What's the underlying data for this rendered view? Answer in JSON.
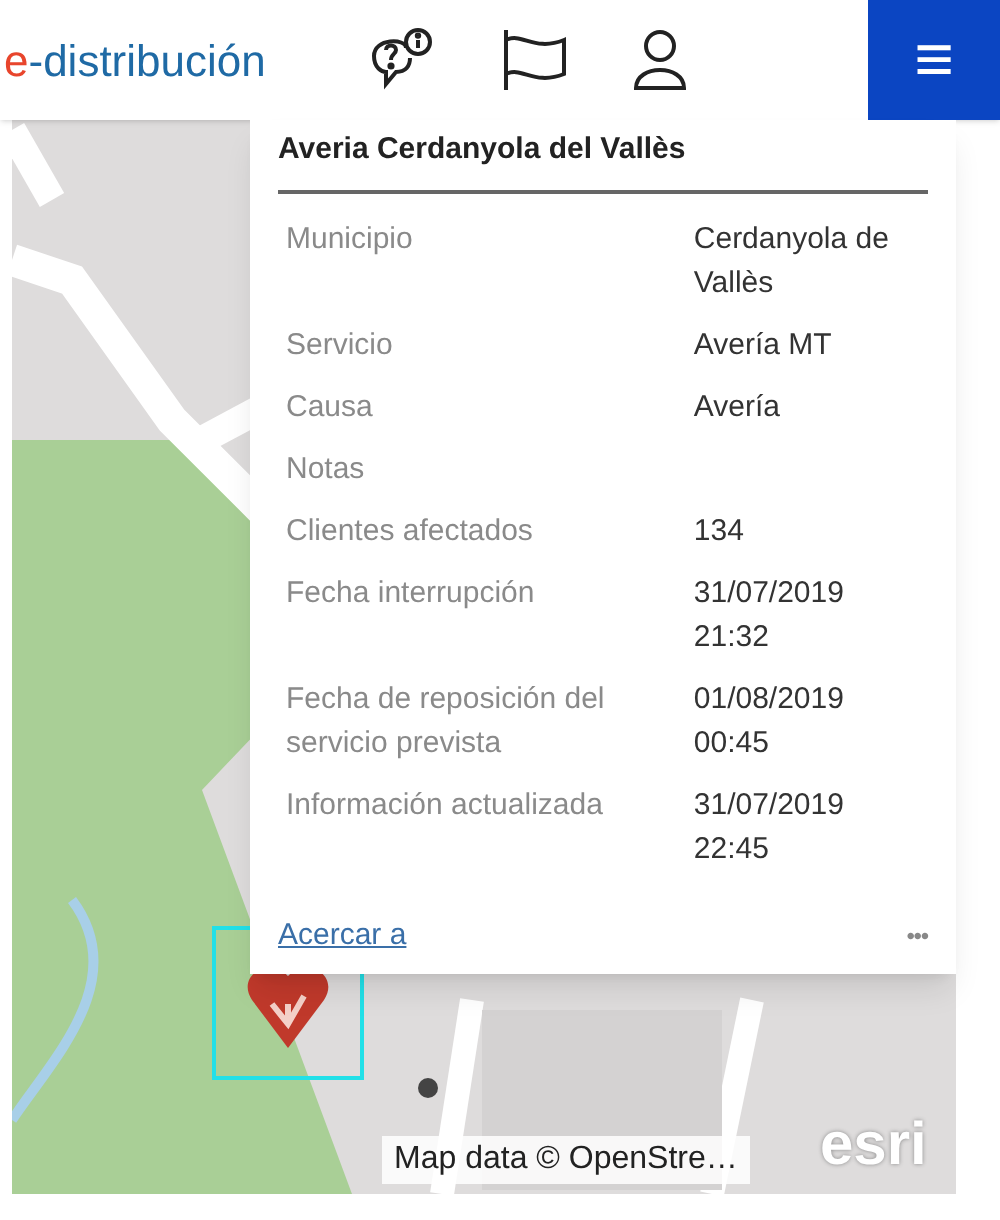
{
  "header": {
    "logo": {
      "mark": "e",
      "text": "-distribución"
    },
    "menu_button": {
      "glyph": "≡"
    }
  },
  "popup": {
    "title": "Averia Cerdanyola del Vallès",
    "fields": [
      {
        "label": "Municipio",
        "value": "Cerdanyola de\nVallès"
      },
      {
        "label": "Servicio",
        "value": "Avería MT"
      },
      {
        "label": "Causa",
        "value": "Avería"
      },
      {
        "label": "Notas"
      },
      {
        "label": "Clientes afectados",
        "value": "134"
      },
      {
        "label": "Fecha interrupción",
        "value": "31/07/2019 21:32"
      },
      {
        "label": "Fecha de reposición del servicio prevista",
        "value": "01/08/2019 00:45"
      },
      {
        "label": "Información actualizada",
        "value": "31/07/2019 22:45"
      }
    ],
    "zoom_link": "Acercar a",
    "more": "•••"
  },
  "map": {
    "attribution": "Map data © OpenStre…",
    "logo": "esri"
  }
}
